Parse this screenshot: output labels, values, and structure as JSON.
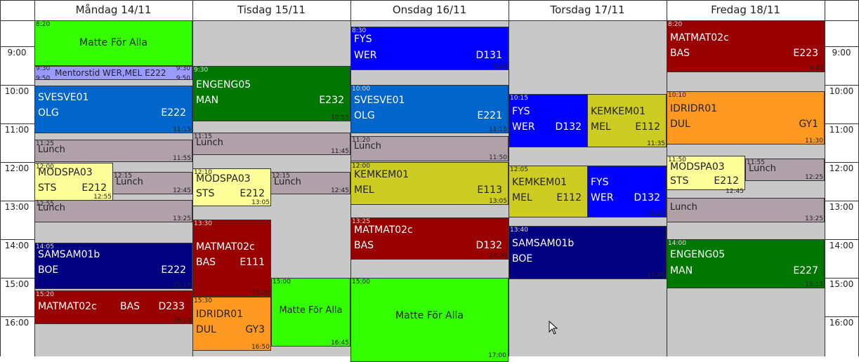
{
  "days": [
    "Måndag 14/11",
    "Tisdag 15/11",
    "Onsdag 16/11",
    "Torsdag 17/11",
    "Fredag 18/11"
  ],
  "time_labels": [
    "9:00",
    "10:00",
    "11:00",
    "12:00",
    "13:00",
    "14:00",
    "15:00",
    "16:00"
  ],
  "colors": {
    "matte": "#33ff00",
    "mentor": "#9999ff",
    "blue_mid": "#0066cc",
    "blue": "#0000ff",
    "navy": "#000080",
    "dark_red": "#990000",
    "green": "#007700",
    "orange": "#ff9922",
    "yellow_green": "#cccc22",
    "lunch": "#b0a0a8",
    "light_yellow": "#ffff99",
    "background": "#c8c8c8"
  },
  "events": {
    "mon_matte": {
      "title": "Matte För Alla",
      "start": "8:20",
      "end": ""
    },
    "mon_mentor": {
      "title": "Mentorstid WER,MEL E222",
      "start": "9:30",
      "end": "9:30",
      "start2": "9:50",
      "end2": "9:50"
    },
    "mon_sve": {
      "title": "SVESVE01",
      "teacher": "OLG",
      "room": "E222",
      "end": "11:15"
    },
    "mon_lunch1": {
      "title": "Lunch",
      "start": "11:25",
      "end": "11:55"
    },
    "mon_modspa": {
      "title": "MODSPA03",
      "teacher": "STS",
      "room": "E212",
      "start": "12:00",
      "end": "12:55"
    },
    "mon_lunch2": {
      "title": "Lunch",
      "start": "12:15",
      "end": "12:45"
    },
    "mon_lunch3": {
      "title": "Lunch",
      "start": "12:55",
      "end": "13:25"
    },
    "mon_sam": {
      "title": "SAMSAM01b",
      "teacher": "BOE",
      "room": "E222",
      "start": "14:05",
      "end": "15:10"
    },
    "mon_mat": {
      "title": "MATMAT02c",
      "teacher": "BAS",
      "room": "D233",
      "start": "15:20",
      "end": "16:10"
    },
    "tue_eng": {
      "title": "ENGENG05",
      "teacher": "MAN",
      "room": "E232",
      "start": "9:30",
      "end": "10:55"
    },
    "tue_lunch1": {
      "title": "Lunch",
      "start": "11:15",
      "end": "11:45"
    },
    "tue_modspa": {
      "title": "MODSPA03",
      "teacher": "STS",
      "room": "E212",
      "start": "12:10",
      "end": "13:05"
    },
    "tue_lunch2": {
      "title": "Lunch",
      "start": "12:15",
      "end": "12:45"
    },
    "tue_mat": {
      "title": "MATMAT02c",
      "teacher": "BAS",
      "room": "E111",
      "start": "13:30",
      "end": "15:20"
    },
    "tue_idr": {
      "title": "IDRIDR01",
      "teacher": "DUL",
      "room": "GY3",
      "start": "15:30",
      "end": "16:50"
    },
    "tue_matte": {
      "title": "Matte För Alla",
      "start": "15:00",
      "end": "16:45"
    },
    "wed_fys": {
      "title": "FYS",
      "teacher": "WER",
      "room": "D131",
      "start": "8:30",
      "end": "9:35"
    },
    "wed_sve": {
      "title": "SVESVE01",
      "teacher": "OLG",
      "room": "E221",
      "start": "10:00",
      "end": "11:15"
    },
    "wed_lunch": {
      "title": "Lunch",
      "start": "11:20",
      "end": "11:50"
    },
    "wed_kem": {
      "title": "KEMKEM01",
      "teacher": "MEL",
      "room": "E113",
      "start": "12:00",
      "end": "13:05"
    },
    "wed_mat": {
      "title": "MATMAT02c",
      "teacher": "BAS",
      "room": "D132",
      "start": "13:25",
      "end": "14:30"
    },
    "wed_matte": {
      "title": "Matte För Alla",
      "start": "15:00",
      "end": "17:00"
    },
    "thu_fys1": {
      "title": "FYS",
      "teacher": "WER",
      "room": "D132",
      "start": "10:15"
    },
    "thu_kem1": {
      "title": "KEMKEM01",
      "teacher": "MEL",
      "room": "E112",
      "end": "11:35"
    },
    "thu_kem2": {
      "title": "KEMKEM01",
      "teacher": "MEL",
      "room": "E112",
      "start": "12:05"
    },
    "thu_fys2": {
      "title": "FYS",
      "teacher": "WER",
      "room": "D132",
      "end": "13:25"
    },
    "thu_sam": {
      "title": "SAMSAM01b",
      "teacher": "BOE",
      "start": "13:40",
      "end": "15:00"
    },
    "fri_mat": {
      "title": "MATMAT02c",
      "teacher": "BAS",
      "room": "E223",
      "start": "8:20",
      "end": "9:40"
    },
    "fri_idr": {
      "title": "IDRIDR01",
      "teacher": "DUL",
      "room": "GY1",
      "start": "10:10",
      "end": "11:30"
    },
    "fri_modspa": {
      "title": "MODSPA03",
      "teacher": "STS",
      "room": "E212",
      "start": "11:50",
      "end": "12:45"
    },
    "fri_lunch1": {
      "title": "Lunch",
      "start": "11:55",
      "end": "12:25"
    },
    "fri_lunch2": {
      "title": "Lunch",
      "end": "13:25"
    },
    "fri_eng": {
      "title": "ENGENG05",
      "teacher": "MAN",
      "room": "E227",
      "start": "14:00",
      "end": "15:15"
    }
  }
}
